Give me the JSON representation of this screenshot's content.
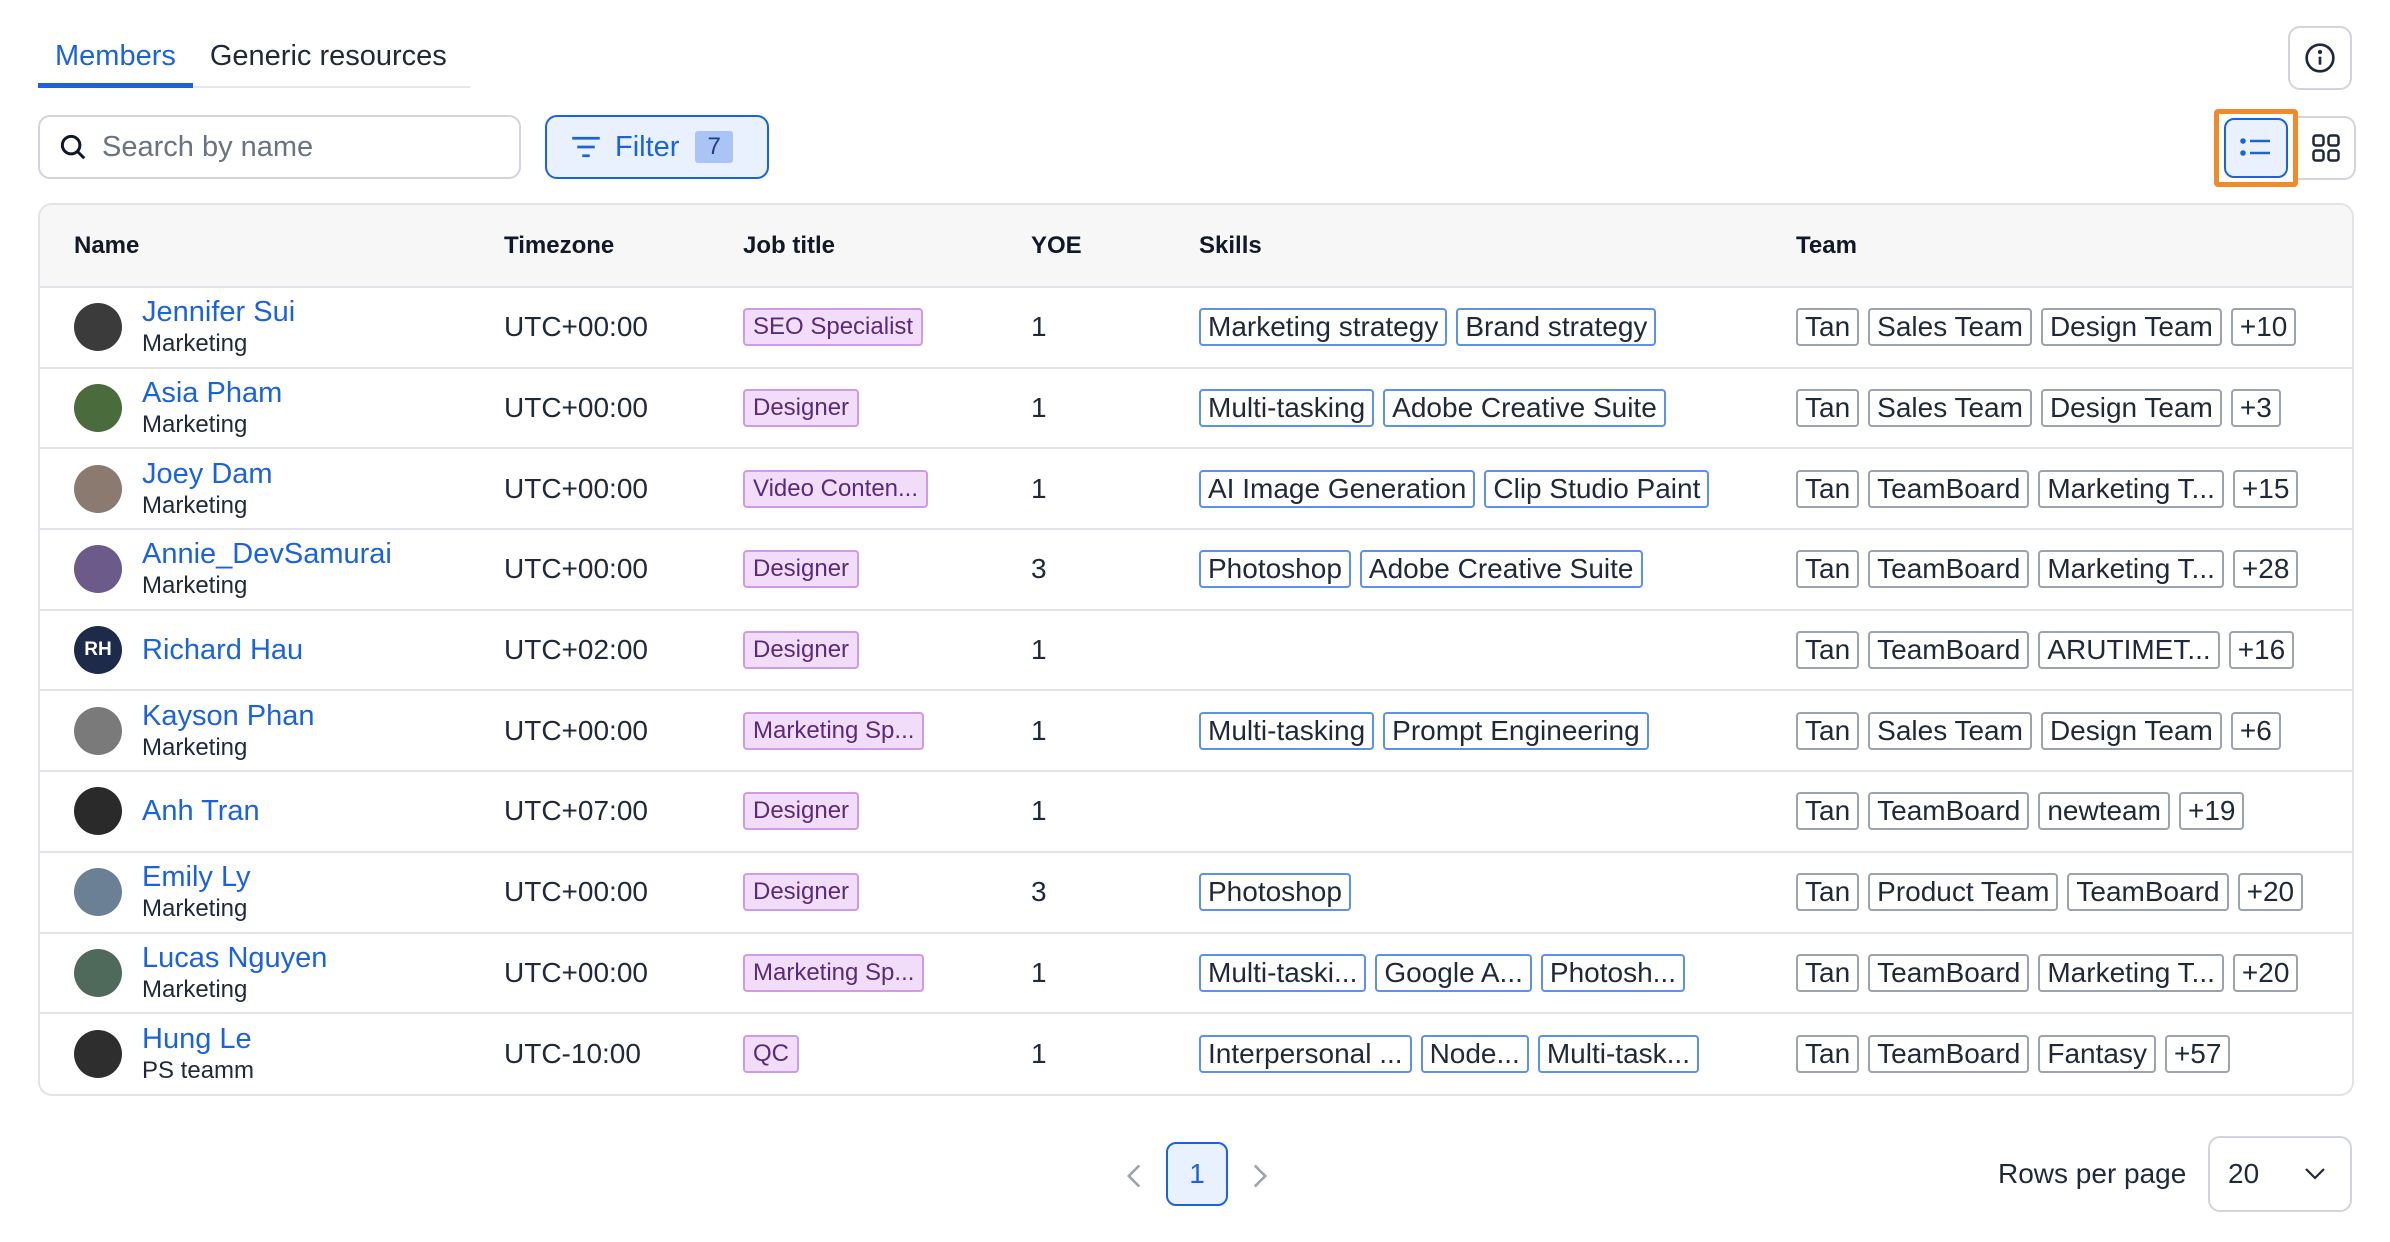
{
  "tabs": [
    {
      "label": "Members",
      "active": true
    },
    {
      "label": "Generic resources",
      "active": false
    }
  ],
  "info_icon": "info-icon",
  "search": {
    "placeholder": "Search by name",
    "icon": "search-icon"
  },
  "filter": {
    "label": "Filter",
    "count": "7",
    "icon": "filter-icon"
  },
  "view_toggle": {
    "active": "list",
    "list_icon": "list-view-icon",
    "grid_icon": "grid-view-icon"
  },
  "colors": {
    "accent": "#1d63d8",
    "highlight": "#f08a2a",
    "job_tag_bg": "#f1ddf9",
    "skill_border": "#5d92e6",
    "team_border": "#9ca3af"
  },
  "table": {
    "columns": [
      "Name",
      "Timezone",
      "Job title",
      "YOE",
      "Skills",
      "Team"
    ],
    "rows": [
      {
        "name": "Jennifer Sui",
        "dept": "Marketing",
        "avatar_color": "#3b3b3b",
        "initials": "",
        "timezone": "UTC+00:00",
        "job": "SEO Specialist",
        "yoe": "1",
        "skills": [
          "Marketing strategy",
          "Brand strategy"
        ],
        "teams": [
          "Tan",
          "Sales Team",
          "Design Team",
          "+10"
        ]
      },
      {
        "name": "Asia Pham",
        "dept": "Marketing",
        "avatar_color": "#4a6b3c",
        "initials": "",
        "timezone": "UTC+00:00",
        "job": "Designer",
        "yoe": "1",
        "skills": [
          "Multi-tasking",
          "Adobe Creative Suite"
        ],
        "teams": [
          "Tan",
          "Sales Team",
          "Design Team",
          "+3"
        ]
      },
      {
        "name": "Joey Dam",
        "dept": "Marketing",
        "avatar_color": "#8a7a70",
        "initials": "",
        "timezone": "UTC+00:00",
        "job": "Video Conten...",
        "yoe": "1",
        "skills": [
          "AI Image Generation",
          "Clip Studio Paint"
        ],
        "teams": [
          "Tan",
          "TeamBoard",
          "Marketing T...",
          "+15"
        ]
      },
      {
        "name": "Annie_DevSamurai",
        "dept": "Marketing",
        "avatar_color": "#6b5a8a",
        "initials": "",
        "timezone": "UTC+00:00",
        "job": "Designer",
        "yoe": "3",
        "skills": [
          "Photoshop",
          "Adobe Creative Suite"
        ],
        "teams": [
          "Tan",
          "TeamBoard",
          "Marketing T...",
          "+28"
        ]
      },
      {
        "name": "Richard Hau",
        "dept": "",
        "avatar_color": "#1e2a4a",
        "initials": "RH",
        "timezone": "UTC+02:00",
        "job": "Designer",
        "yoe": "1",
        "skills": [],
        "teams": [
          "Tan",
          "TeamBoard",
          "ARUTIMET...",
          "+16"
        ]
      },
      {
        "name": "Kayson Phan",
        "dept": "Marketing",
        "avatar_color": "#7a7a7a",
        "initials": "",
        "timezone": "UTC+00:00",
        "job": "Marketing Sp...",
        "yoe": "1",
        "skills": [
          "Multi-tasking",
          "Prompt Engineering"
        ],
        "teams": [
          "Tan",
          "Sales Team",
          "Design Team",
          "+6"
        ]
      },
      {
        "name": "Anh Tran",
        "dept": "",
        "avatar_color": "#2a2a2a",
        "initials": "",
        "timezone": "UTC+07:00",
        "job": "Designer",
        "yoe": "1",
        "skills": [],
        "teams": [
          "Tan",
          "TeamBoard",
          "newteam",
          "+19"
        ]
      },
      {
        "name": "Emily Ly",
        "dept": "Marketing",
        "avatar_color": "#6b7f95",
        "initials": "",
        "timezone": "UTC+00:00",
        "job": "Designer",
        "yoe": "3",
        "skills": [
          "Photoshop"
        ],
        "teams": [
          "Tan",
          "Product Team",
          "TeamBoard",
          "+20"
        ]
      },
      {
        "name": "Lucas Nguyen",
        "dept": "Marketing",
        "avatar_color": "#4f6a5a",
        "initials": "",
        "timezone": "UTC+00:00",
        "job": "Marketing Sp...",
        "yoe": "1",
        "skills": [
          "Multi-taski...",
          "Google A...",
          "Photosh..."
        ],
        "teams": [
          "Tan",
          "TeamBoard",
          "Marketing T...",
          "+20"
        ]
      },
      {
        "name": "Hung Le",
        "dept": "PS teamm",
        "avatar_color": "#2e2e2e",
        "initials": "",
        "timezone": "UTC-10:00",
        "job": "QC",
        "yoe": "1",
        "skills": [
          "Interpersonal ...",
          "Node...",
          "Multi-task..."
        ],
        "teams": [
          "Tan",
          "TeamBoard",
          "Fantasy",
          "+57"
        ]
      }
    ]
  },
  "pagination": {
    "current_page": "1",
    "prev_icon": "chevron-left-icon",
    "next_icon": "chevron-right-icon"
  },
  "rows_per_page": {
    "label": "Rows per page",
    "value": "20",
    "icon": "chevron-down-icon"
  }
}
